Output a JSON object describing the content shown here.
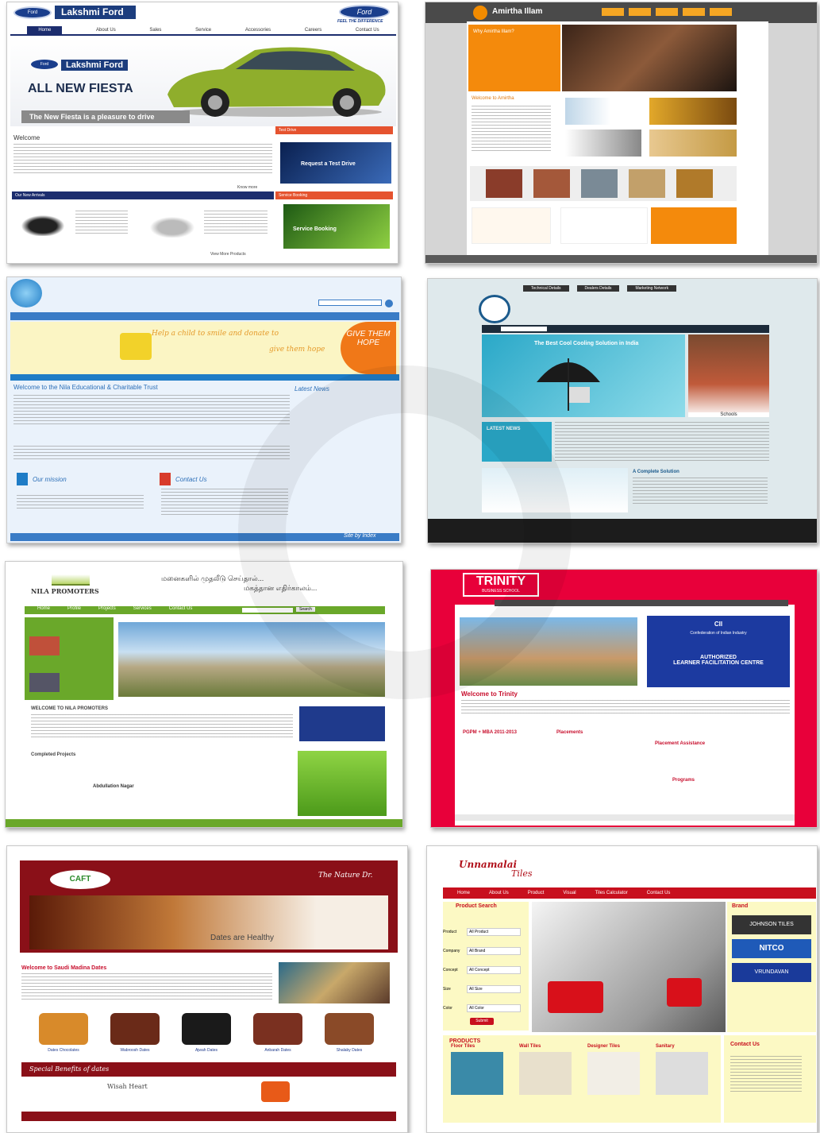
{
  "ford": {
    "brand": "Lakshmi Ford",
    "logo": "Ford",
    "tagline": "FEEL THE DIFFERENCE",
    "nav": [
      "Home",
      "About Us",
      "Sales",
      "Service",
      "Accessories",
      "Careers",
      "Contact Us"
    ],
    "hero_title": "ALL NEW FIESTA",
    "hero_sub": "The New Fiesta is a pleasure to drive",
    "welcome": "Welcome",
    "test_drive": "Test Drive",
    "request_btn": "Request a Test Drive",
    "new_arrivals": "Our New Arrivals",
    "service_booking_tab": "Service Booking",
    "service_btn": "Service Booking",
    "know_more": "Know more",
    "view_more": "View More Products"
  },
  "amirtha": {
    "brand": "Amirtha Illam",
    "why": "Why Amirtha Illam?",
    "welcome": "Welcome to Amirtha"
  },
  "nila_trust": {
    "hope1": "GIVE THEM",
    "hope2": "HOPE",
    "slogan1": "Help a child to smile and donate to",
    "slogan2": "give them hope",
    "title": "Welcome to the Nila Educational & Charitable Trust",
    "latest": "Latest News",
    "mission": "Our mission",
    "contact": "Contact Us",
    "footer": "Site by Index"
  },
  "solar": {
    "tabs": [
      "Technical Details",
      "Dealers Details",
      "Marketing Network"
    ],
    "headline": "The Best Cool Cooling Solution in India",
    "latest": "LATEST NEWS",
    "complete": "A Complete Solution",
    "schools": "Schools"
  },
  "nila_promoters": {
    "brand": "NILA PROMOTERS",
    "tamil1": "மனைகளில் முதலீடு செய்தால்...",
    "tamil2": "மகத்தான எதிர்காலம்...",
    "nav": [
      "Home",
      "Profile",
      "Projects",
      "Services",
      "Contact Us"
    ],
    "search_btn": "Search",
    "welcome": "WELCOME TO NILA PROMOTERS",
    "completed": "Completed Projects",
    "project": "Abdullation Nagar"
  },
  "trinity": {
    "brand": "TRINITY",
    "sub": "BUSINESS SCHOOL",
    "cii": "CII",
    "cii_text": "Confederation of Indian Industry",
    "authorized": "AUTHORIZED",
    "learner": "LEARNER FACILITATION CENTRE",
    "welcome": "Welcome to Trinity",
    "pgpm": "PGPM + MBA 2011-2013",
    "placements": "Placements",
    "placement_assist": "Placement Assistance",
    "programs": "Programs"
  },
  "dates": {
    "brand": "The Nature Dr.",
    "logo": "CAFT",
    "banner": "Dates are Healthy",
    "welcome": "Welcome to Saudi Madina Dates",
    "benefits": "Special Benefits of dates",
    "wisdom": "Wisah Heart",
    "products": [
      "Dates Chocolates",
      "Wabroosh Dates",
      "Ajwah Dates",
      "Anbarah Dates",
      "Shalaby Dates"
    ]
  },
  "tiles": {
    "brand": "Unnamalai",
    "brand2": "Tiles",
    "nav": [
      "Home",
      "About Us",
      "Product",
      "Visual",
      "Tiles Calculator",
      "Contact Us"
    ],
    "search": "Product Search",
    "brand_label": "Brand",
    "fields": [
      {
        "label": "Product",
        "value": "All Product"
      },
      {
        "label": "Company",
        "value": "All Brand"
      },
      {
        "label": "Concept",
        "value": "All Concept"
      },
      {
        "label": "Size",
        "value": "All Size"
      },
      {
        "label": "Color",
        "value": "All Color"
      }
    ],
    "submit": "Submit",
    "products": "PRODUCTS",
    "categories": [
      "Floor Tiles",
      "Wall Tiles",
      "Designer Tiles",
      "Sanitary"
    ],
    "contact": "Contact Us",
    "b1": "JOHNSON TILES",
    "b2": "NITCO",
    "b3": "VRUNDAVAN"
  }
}
